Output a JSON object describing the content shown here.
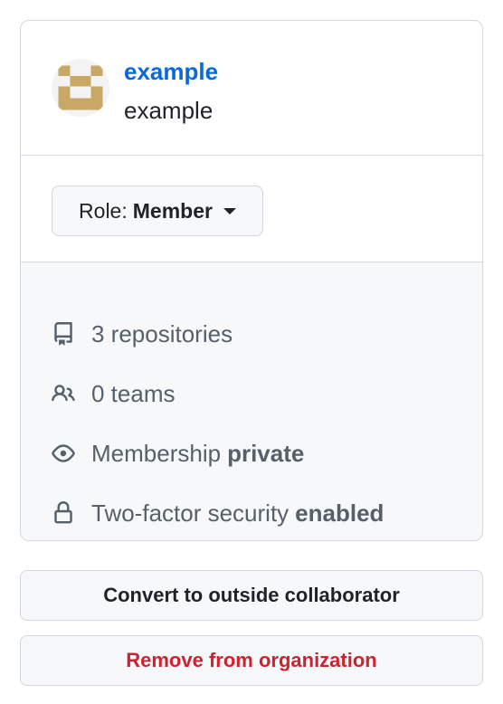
{
  "member": {
    "login": "example",
    "name": "example"
  },
  "role": {
    "prefix": "Role:",
    "value": "Member"
  },
  "details": {
    "repositories": "3 repositories",
    "teams": "0 teams",
    "membership_label": "Membership",
    "membership_value": "private",
    "two_factor_label": "Two-factor security",
    "two_factor_value": "enabled"
  },
  "actions": {
    "convert": "Convert to outside collaborator",
    "remove": "Remove from organization"
  },
  "colors": {
    "link": "#0969da",
    "danger": "#cf222e",
    "border": "#d0d7de",
    "avatar_pattern": "#c9a765"
  },
  "icons": [
    "repo-icon",
    "people-icon",
    "eye-icon",
    "lock-icon",
    "triangle-down-icon"
  ]
}
